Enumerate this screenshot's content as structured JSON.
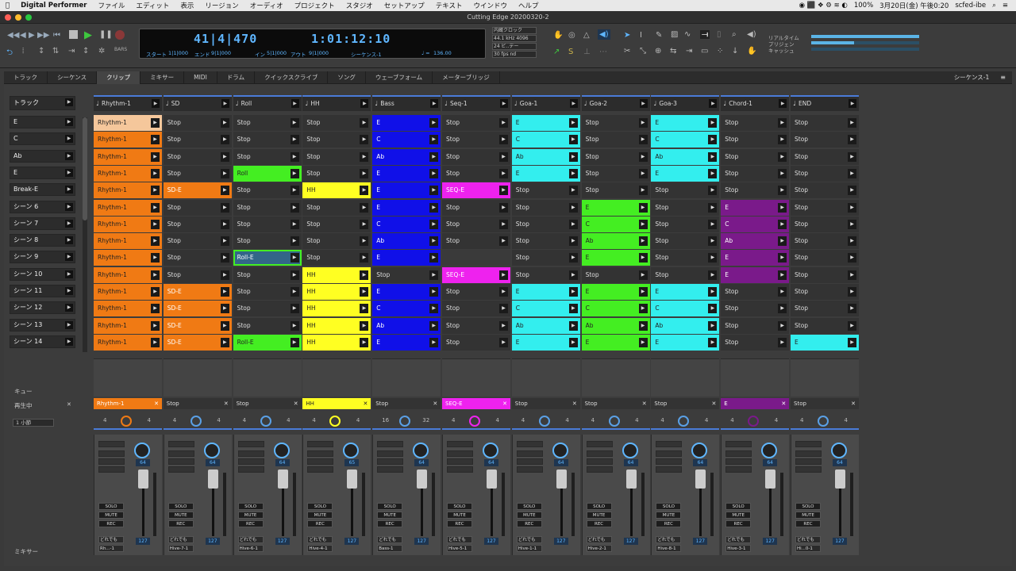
{
  "menubar": {
    "app_name": "Digital Performer",
    "items": [
      "ファイル",
      "エディット",
      "表示",
      "リージョン",
      "オーディオ",
      "プロジェクト",
      "スタジオ",
      "セットアップ",
      "テキスト",
      "ウインドウ",
      "ヘルプ"
    ],
    "battery": "100%",
    "datetime": "3月20日(金) 午後0:20",
    "user": "scfed-ibe"
  },
  "window": {
    "title": "Cutting Edge 20200320-2"
  },
  "transport": {
    "position_bbt": "41|4|470",
    "position_time": "1:01:12:10",
    "start_label": "スタート",
    "start_value": "1|1|000",
    "end_label": "エンド",
    "end_value": "9|1|000",
    "in_label": "イン",
    "in_value": "5|1|000",
    "out_label": "アウト",
    "out_value": "9|1|000",
    "sequence_label": "シーケンス-1",
    "tempo": "136.00",
    "bars_label": "BARS",
    "clock": "内蔵クロック",
    "sample_rate": "44.1 kHz",
    "buffer": "4096",
    "bit_depth": "24 ビ..デー",
    "frame_rate": "30 fps nd",
    "right_info": [
      "リアルタイム",
      "プリジェン",
      "キャッシュ"
    ]
  },
  "tabs": [
    "トラック",
    "シーケンス",
    "クリップ",
    "ミキサー",
    "MIDI",
    "ドラム",
    "クイックスクライブ",
    "ソング",
    "ウェーブフォーム",
    "メーターブリッジ"
  ],
  "active_tab": "クリップ",
  "sequence_selector": "シーケンス-1",
  "sidebar": {
    "header": "トラック",
    "scenes": [
      "E",
      "C",
      "Ab",
      "E",
      "Break-E",
      "シーン 6",
      "シーン 7",
      "シーン 8",
      "シーン 9",
      "シーン 10",
      "シーン 11",
      "シーン 12",
      "シーン 13",
      "シーン 14"
    ],
    "cue_label": "キュー",
    "playing_label": "再生中",
    "quantize": "1 小節",
    "mixer_label": "ミキサー"
  },
  "columns": [
    {
      "name": "Rhythm-1",
      "color": "#f07a14",
      "light": "#f5c79b"
    },
    {
      "name": "SD",
      "color": "#f07a14"
    },
    {
      "name": "Roll",
      "color": "#44ee22"
    },
    {
      "name": "HH",
      "color": "#ffff22"
    },
    {
      "name": "Bass",
      "color": "#1010e8"
    },
    {
      "name": "Seq-1",
      "color": "#ee22ee"
    },
    {
      "name": "Goa-1",
      "color": "#33eeee"
    },
    {
      "name": "Goa-2",
      "color": "#44ee22"
    },
    {
      "name": "Goa-3",
      "color": "#33eeee"
    },
    {
      "name": "Chord-1",
      "color": "#7a1a8a"
    },
    {
      "name": "END",
      "color": "#33eeee"
    }
  ],
  "grid": [
    [
      "Rhythm-1",
      "Stop",
      "Stop",
      "Stop",
      "E",
      "Stop",
      "E",
      "Stop",
      "E",
      "Stop",
      "Stop"
    ],
    [
      "Rhythm-1",
      "Stop",
      "Stop",
      "Stop",
      "C",
      "Stop",
      "C",
      "Stop",
      "C",
      "Stop",
      "Stop"
    ],
    [
      "Rhythm-1",
      "Stop",
      "Stop",
      "Stop",
      "Ab",
      "Stop",
      "Ab",
      "Stop",
      "Ab",
      "Stop",
      "Stop"
    ],
    [
      "Rhythm-1",
      "Stop",
      "Roll",
      "Stop",
      "E",
      "Stop",
      "E",
      "Stop",
      "E",
      "Stop",
      "Stop"
    ],
    [
      "Rhythm-1",
      "SD-E",
      "Stop",
      "HH",
      "E",
      "SEQ-E",
      "Stop",
      "Stop",
      "Stop",
      "Stop",
      "Stop"
    ],
    [
      "Rhythm-1",
      "Stop",
      "Stop",
      "Stop",
      "E",
      "Stop",
      "Stop",
      "E",
      "Stop",
      "E",
      "Stop"
    ],
    [
      "Rhythm-1",
      "Stop",
      "Stop",
      "Stop",
      "C",
      "Stop",
      "Stop",
      "C",
      "Stop",
      "C",
      "Stop"
    ],
    [
      "Rhythm-1",
      "Stop",
      "Stop",
      "Stop",
      "Ab",
      "Stop",
      "Stop",
      "Ab",
      "Stop",
      "Ab",
      "Stop"
    ],
    [
      "Rhythm-1",
      "Stop",
      "Roll-E",
      "Stop",
      "E",
      "",
      "Stop",
      "E",
      "Stop",
      "E",
      "Stop"
    ],
    [
      "Rhythm-1",
      "Stop",
      "Stop",
      "HH",
      "Stop",
      "SEQ-E",
      "Stop",
      "Stop",
      "Stop",
      "E",
      "Stop"
    ],
    [
      "Rhythm-1",
      "SD-E",
      "Stop",
      "HH",
      "E",
      "Stop",
      "E",
      "E",
      "E",
      "Stop",
      "Stop"
    ],
    [
      "Rhythm-1",
      "SD-E",
      "Stop",
      "HH",
      "C",
      "Stop",
      "C",
      "C",
      "C",
      "Stop",
      "Stop"
    ],
    [
      "Rhythm-1",
      "SD-E",
      "Stop",
      "HH",
      "Ab",
      "Stop",
      "Ab",
      "Ab",
      "Ab",
      "Stop",
      "Stop"
    ],
    [
      "Rhythm-1",
      "SD-E",
      "Roll-E",
      "HH",
      "E",
      "Stop",
      "E",
      "E",
      "E",
      "Stop",
      "E"
    ]
  ],
  "now_playing": [
    "Rhythm-1",
    "Stop",
    "Stop",
    "HH",
    "Stop",
    "SEQ-E",
    "Stop",
    "Stop",
    "Stop",
    "E",
    "Stop"
  ],
  "loop_a": [
    "4",
    "4",
    "4",
    "4",
    "16",
    "4",
    "4",
    "4",
    "4",
    "4",
    "4"
  ],
  "loop_b": [
    "4",
    "4",
    "4",
    "4",
    "32",
    "4",
    "4",
    "4",
    "4",
    "4",
    "4"
  ],
  "mixer": {
    "pans": [
      "64",
      "64",
      "64",
      "65",
      "64",
      "64",
      "64",
      "64",
      "64",
      "64",
      "64"
    ],
    "volumes": [
      "127",
      "127",
      "127",
      "127",
      "127",
      "127",
      "127",
      "127",
      "127",
      "127",
      "127"
    ],
    "inputs": [
      "どれでも",
      "どれでも",
      "どれでも",
      "どれでも",
      "どれでも",
      "どれでも",
      "どれでも",
      "どれでも",
      "どれでも",
      "どれでも",
      "どれでも"
    ],
    "outputs": [
      "Rh...-1",
      "Hive-7-1",
      "Hive-6-1",
      "Hive-4-1",
      "Bass-1",
      "Hive-5-1",
      "Hive-1-1",
      "Hive-2-1",
      "Hive-8-1",
      "Hive-3-1",
      "Hi...0-1"
    ],
    "solo": "SOLO",
    "mute": "MUTE",
    "rec": "REC"
  }
}
